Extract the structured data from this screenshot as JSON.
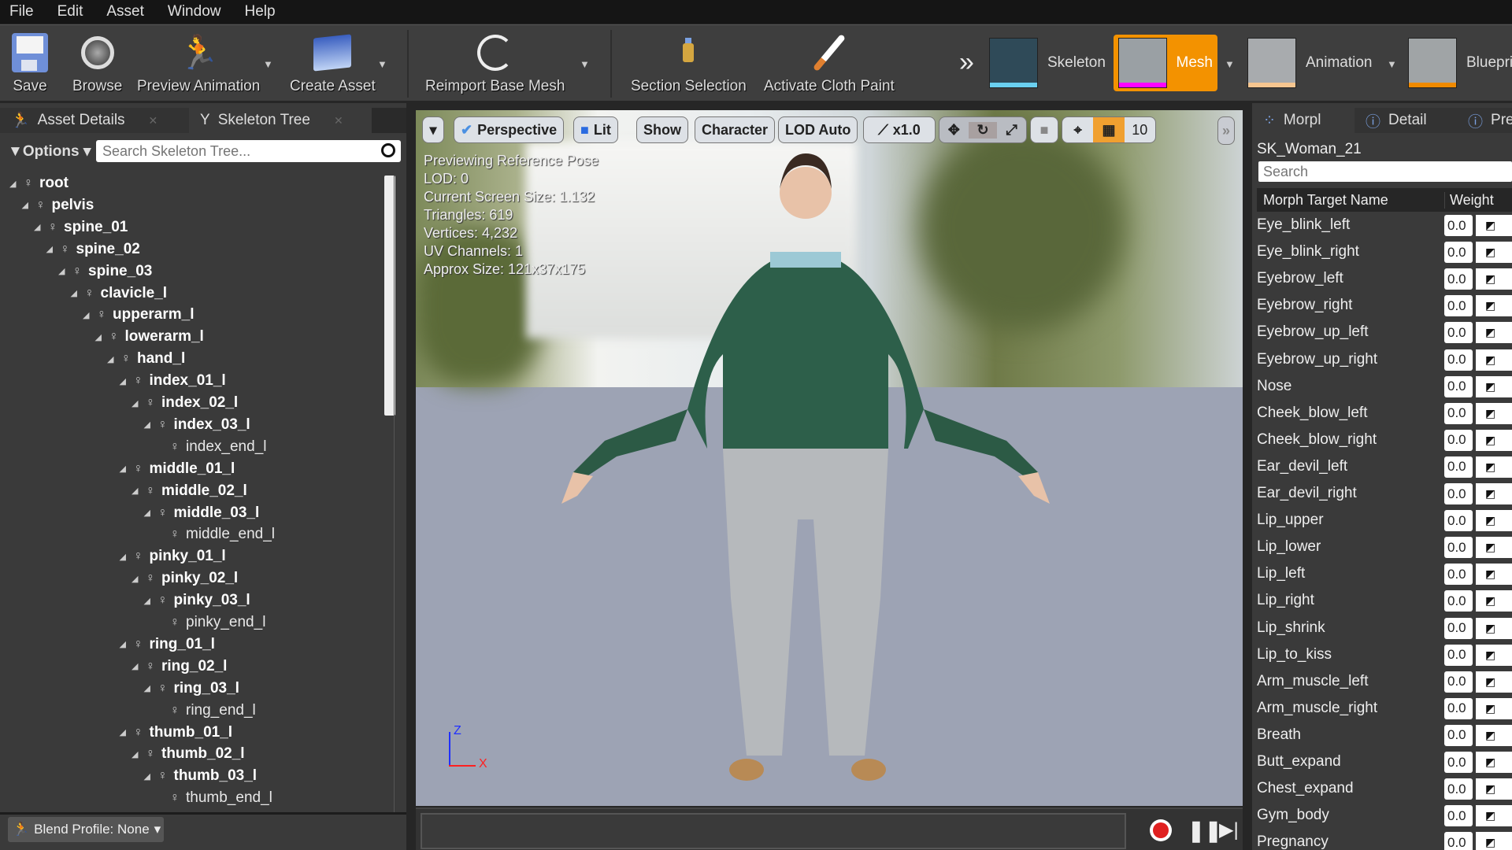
{
  "menu": [
    "File",
    "Edit",
    "Asset",
    "Window",
    "Help"
  ],
  "toolbar": {
    "save": "Save",
    "browse": "Browse",
    "preview_animation": "Preview Animation",
    "create_asset": "Create Asset",
    "reimport": "Reimport Base Mesh",
    "section_selection": "Section Selection",
    "cloth_paint": "Activate Cloth Paint",
    "overflow": "»",
    "assets": {
      "skeleton": "Skeleton",
      "mesh": "Mesh",
      "animation": "Animation",
      "blueprint": "Bluepri"
    }
  },
  "left": {
    "tabs": [
      "Asset Details",
      "Skeleton Tree"
    ],
    "options": "Options",
    "search_placeholder": "Search Skeleton Tree...",
    "blend_profile": "Blend Profile: None",
    "bones": [
      {
        "name": "root",
        "depth": 0
      },
      {
        "name": "pelvis",
        "depth": 1
      },
      {
        "name": "spine_01",
        "depth": 2
      },
      {
        "name": "spine_02",
        "depth": 3
      },
      {
        "name": "spine_03",
        "depth": 4
      },
      {
        "name": "clavicle_l",
        "depth": 5
      },
      {
        "name": "upperarm_l",
        "depth": 6
      },
      {
        "name": "lowerarm_l",
        "depth": 7
      },
      {
        "name": "hand_l",
        "depth": 8
      },
      {
        "name": "index_01_l",
        "depth": 9
      },
      {
        "name": "index_02_l",
        "depth": 10
      },
      {
        "name": "index_03_l",
        "depth": 11
      },
      {
        "name": "index_end_l",
        "depth": 12,
        "leaf": true
      },
      {
        "name": "middle_01_l",
        "depth": 9
      },
      {
        "name": "middle_02_l",
        "depth": 10
      },
      {
        "name": "middle_03_l",
        "depth": 11
      },
      {
        "name": "middle_end_l",
        "depth": 12,
        "leaf": true
      },
      {
        "name": "pinky_01_l",
        "depth": 9
      },
      {
        "name": "pinky_02_l",
        "depth": 10
      },
      {
        "name": "pinky_03_l",
        "depth": 11
      },
      {
        "name": "pinky_end_l",
        "depth": 12,
        "leaf": true
      },
      {
        "name": "ring_01_l",
        "depth": 9
      },
      {
        "name": "ring_02_l",
        "depth": 10
      },
      {
        "name": "ring_03_l",
        "depth": 11
      },
      {
        "name": "ring_end_l",
        "depth": 12,
        "leaf": true
      },
      {
        "name": "thumb_01_l",
        "depth": 9
      },
      {
        "name": "thumb_02_l",
        "depth": 10
      },
      {
        "name": "thumb_03_l",
        "depth": 11
      },
      {
        "name": "thumb_end_l",
        "depth": 12,
        "leaf": true
      }
    ]
  },
  "viewport": {
    "buttons": {
      "perspective": "Perspective",
      "lit": "Lit",
      "show": "Show",
      "character": "Character",
      "lod": "LOD Auto",
      "speed": "x1.0",
      "grid_size": "10"
    },
    "stats": [
      "Previewing Reference Pose",
      "LOD: 0",
      "Current Screen Size: 1.132",
      "Triangles: 619",
      "Vertices: 4,232",
      "UV Channels: 1",
      "Approx Size: 121x37x175"
    ],
    "axis": {
      "z": "Z",
      "x": "X"
    }
  },
  "right": {
    "tabs": [
      "Morpl",
      "Detail",
      "Pre"
    ],
    "mesh_name": "SK_Woman_21",
    "search_placeholder": "Search",
    "col_name": "Morph Target Name",
    "col_weight": "Weight",
    "morphs": [
      {
        "name": "Eye_blink_left",
        "weight": "0.0"
      },
      {
        "name": "Eye_blink_right",
        "weight": "0.0"
      },
      {
        "name": "Eyebrow_left",
        "weight": "0.0"
      },
      {
        "name": "Eyebrow_right",
        "weight": "0.0"
      },
      {
        "name": "Eyebrow_up_left",
        "weight": "0.0"
      },
      {
        "name": "Eyebrow_up_right",
        "weight": "0.0"
      },
      {
        "name": "Nose",
        "weight": "0.0"
      },
      {
        "name": "Cheek_blow_left",
        "weight": "0.0"
      },
      {
        "name": "Cheek_blow_right",
        "weight": "0.0"
      },
      {
        "name": "Ear_devil_left",
        "weight": "0.0"
      },
      {
        "name": "Ear_devil_right",
        "weight": "0.0"
      },
      {
        "name": "Lip_upper",
        "weight": "0.0"
      },
      {
        "name": "Lip_lower",
        "weight": "0.0"
      },
      {
        "name": "Lip_left",
        "weight": "0.0"
      },
      {
        "name": "Lip_right",
        "weight": "0.0"
      },
      {
        "name": "Lip_shrink",
        "weight": "0.0"
      },
      {
        "name": "Lip_to_kiss",
        "weight": "0.0"
      },
      {
        "name": "Arm_muscle_left",
        "weight": "0.0"
      },
      {
        "name": "Arm_muscle_right",
        "weight": "0.0"
      },
      {
        "name": "Breath",
        "weight": "0.0"
      },
      {
        "name": "Butt_expand",
        "weight": "0.0"
      },
      {
        "name": "Chest_expand",
        "weight": "0.0"
      },
      {
        "name": "Gym_body",
        "weight": "0.0"
      },
      {
        "name": "Pregnancy",
        "weight": "0.0"
      }
    ]
  },
  "colors": {
    "accent": "#f39c12",
    "mesh_bar": "#ff00ff",
    "skeleton_bar": "#6ad0f0",
    "record": "#e02020"
  }
}
